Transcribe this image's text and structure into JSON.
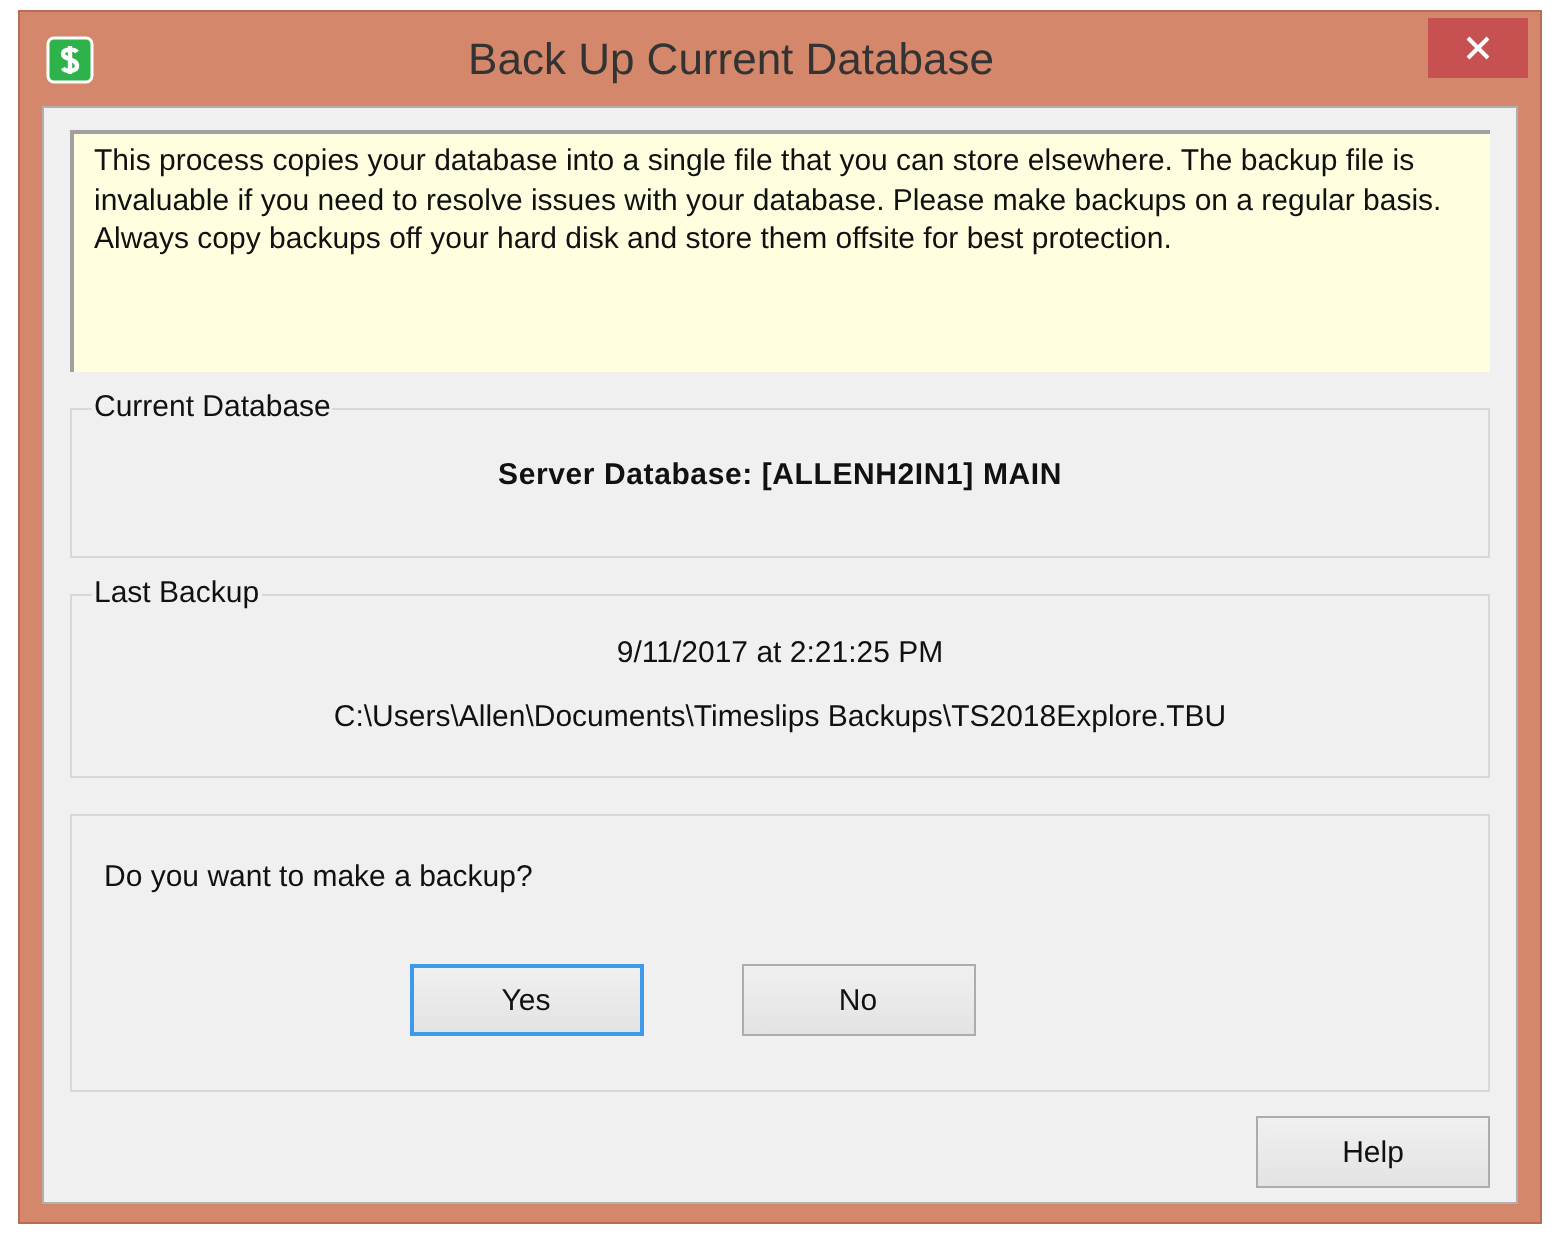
{
  "window": {
    "title": "Back Up Current Database"
  },
  "info": "This process copies your database into a single file that you can store elsewhere. The backup file is invaluable if you need to resolve issues with your database. Please make backups on a regular basis. Always copy backups off your hard disk and store them offsite for best protection.",
  "current_database": {
    "label": "Current Database",
    "value": "Server Database: [ALLENH2IN1] MAIN"
  },
  "last_backup": {
    "label": "Last Backup",
    "date": "9/11/2017 at 2:21:25 PM",
    "path": "C:\\Users\\Allen\\Documents\\Timeslips Backups\\TS2018Explore.TBU"
  },
  "question": {
    "text": "Do you want to make a backup?",
    "buttons": [
      {
        "label": "Yes",
        "default": true
      },
      {
        "label": "No",
        "default": false
      }
    ]
  },
  "help_button": "Help"
}
